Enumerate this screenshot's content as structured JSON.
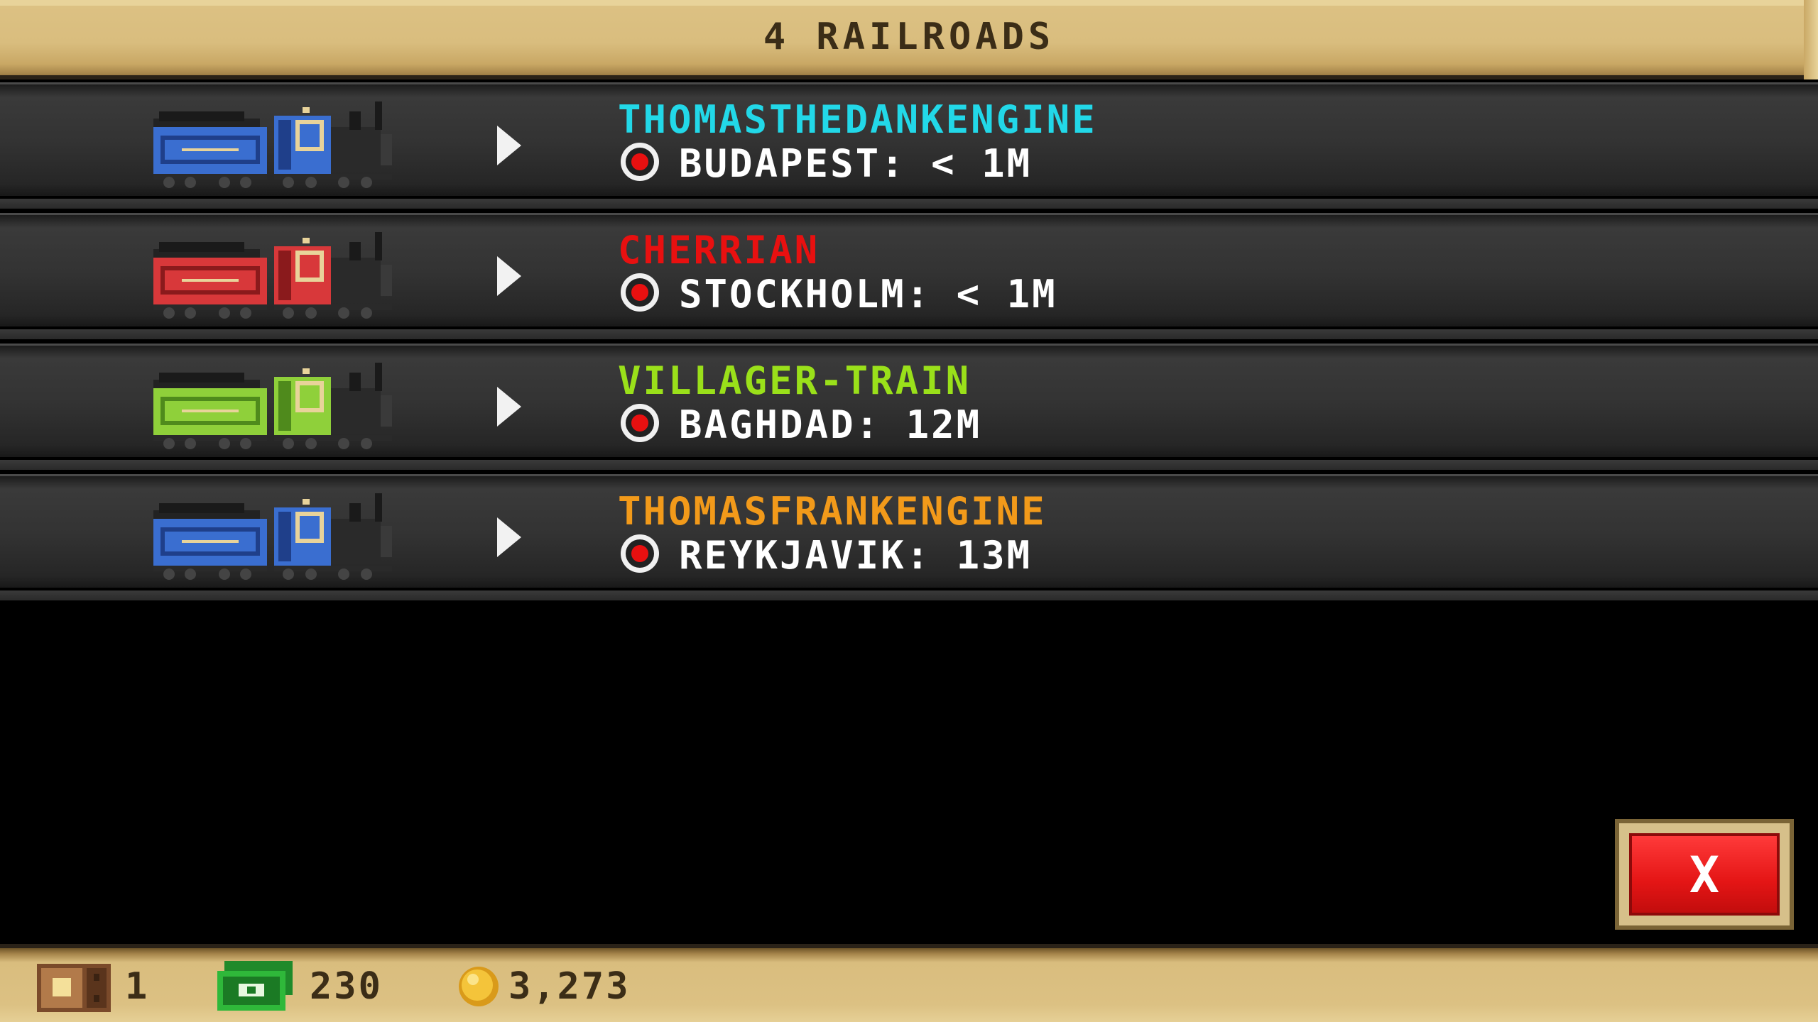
{
  "header": {
    "title": "4 RAILROADS"
  },
  "railroads": [
    {
      "name": "THOMASTHEDANKENGINE",
      "name_color": "#22d8e8",
      "location": "BUDAPEST: < 1M",
      "train_color": "#3a6ed0",
      "train_dark": "#1f3f8a"
    },
    {
      "name": "CHERRIAN",
      "name_color": "#e81010",
      "location": "STOCKHOLM: < 1M",
      "train_color": "#d8383a",
      "train_dark": "#8a1a1c"
    },
    {
      "name": "VILLAGER-TRAIN",
      "name_color": "#9ae01a",
      "location": "BAGHDAD: 12M",
      "train_color": "#8fd03a",
      "train_dark": "#4f8a1c"
    },
    {
      "name": "THOMASFRANKENGINE",
      "name_color": "#f29a1a",
      "location": "REYKJAVIK: 13M",
      "train_color": "#3a6ed0",
      "train_dark": "#1f3f8a"
    }
  ],
  "close_button": {
    "label": "X"
  },
  "status": {
    "crates": "1",
    "cash": "230",
    "coins": "3,273"
  },
  "icons": {
    "row_arrow": "play-arrow-icon",
    "location": "location-pin-icon",
    "crate": "crate-icon",
    "cash": "cash-icon",
    "coin": "coin-icon"
  }
}
